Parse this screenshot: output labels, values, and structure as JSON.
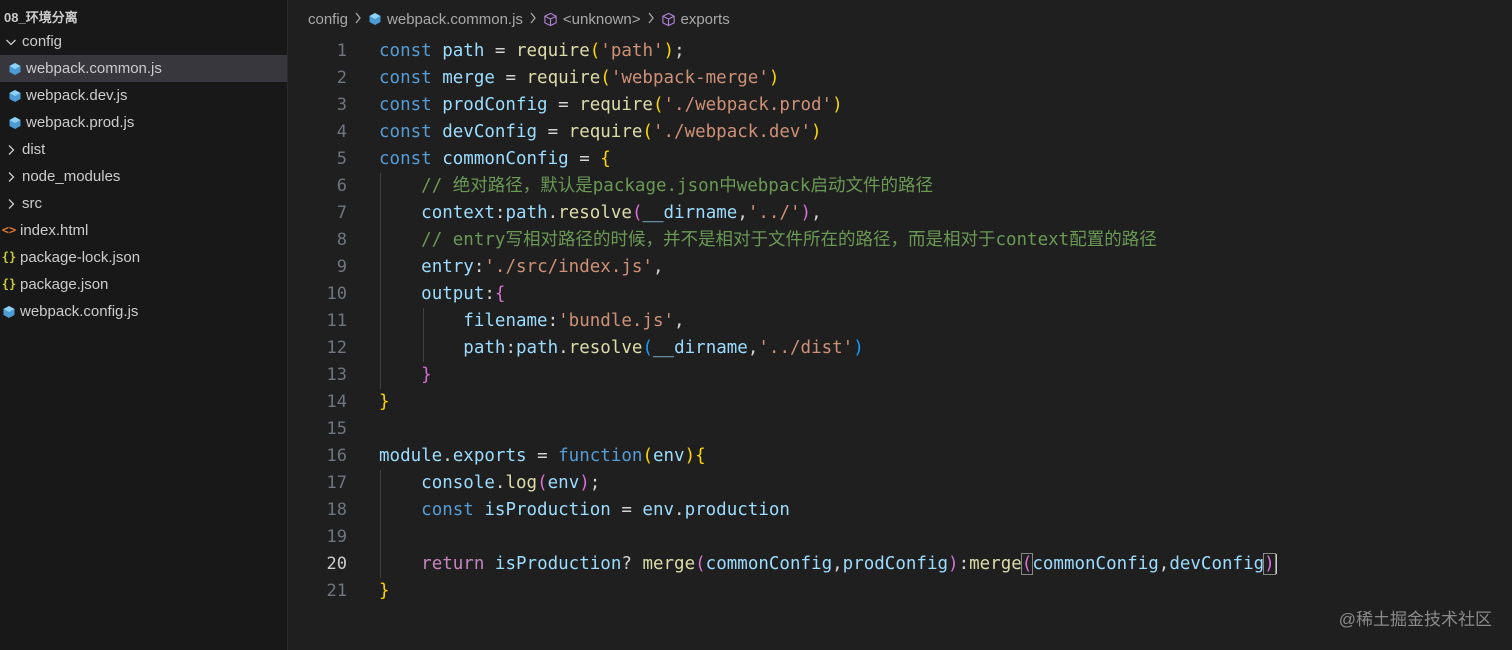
{
  "sidebar": {
    "title": "08_环境分离",
    "items": [
      {
        "label": "config",
        "type": "folder-open",
        "indent": 0
      },
      {
        "label": "webpack.common.js",
        "type": "js",
        "indent": 1,
        "selected": true
      },
      {
        "label": "webpack.dev.js",
        "type": "js",
        "indent": 1
      },
      {
        "label": "webpack.prod.js",
        "type": "js",
        "indent": 1
      },
      {
        "label": "dist",
        "type": "folder",
        "indent": 0
      },
      {
        "label": "node_modules",
        "type": "folder",
        "indent": 0
      },
      {
        "label": "src",
        "type": "folder",
        "indent": 0
      },
      {
        "label": "index.html",
        "type": "html",
        "indent": 0
      },
      {
        "label": "package-lock.json",
        "type": "json",
        "indent": 0
      },
      {
        "label": "package.json",
        "type": "json",
        "indent": 0
      },
      {
        "label": "webpack.config.js",
        "type": "js",
        "indent": 0
      }
    ]
  },
  "breadcrumb": {
    "folder": "config",
    "file": "webpack.common.js",
    "symbol1": "<unknown>",
    "symbol2": "exports"
  },
  "editor": {
    "active_line": 20,
    "lines": [
      [
        [
          "kw",
          "const "
        ],
        [
          "id",
          "path"
        ],
        [
          "pl",
          " = "
        ],
        [
          "fn",
          "require"
        ],
        [
          "p1",
          "("
        ],
        [
          "str",
          "'path'"
        ],
        [
          "p1",
          ")"
        ],
        [
          "pl",
          ";"
        ]
      ],
      [
        [
          "kw",
          "const "
        ],
        [
          "id",
          "merge"
        ],
        [
          "pl",
          " = "
        ],
        [
          "fn",
          "require"
        ],
        [
          "p1",
          "("
        ],
        [
          "str",
          "'webpack-merge'"
        ],
        [
          "p1",
          ")"
        ]
      ],
      [
        [
          "kw",
          "const "
        ],
        [
          "id",
          "prodConfig"
        ],
        [
          "pl",
          " = "
        ],
        [
          "fn",
          "require"
        ],
        [
          "p1",
          "("
        ],
        [
          "str",
          "'./webpack.prod'"
        ],
        [
          "p1",
          ")"
        ]
      ],
      [
        [
          "kw",
          "const "
        ],
        [
          "id",
          "devConfig"
        ],
        [
          "pl",
          " = "
        ],
        [
          "fn",
          "require"
        ],
        [
          "p1",
          "("
        ],
        [
          "str",
          "'./webpack.dev'"
        ],
        [
          "p1",
          ")"
        ]
      ],
      [
        [
          "kw",
          "const "
        ],
        [
          "id",
          "commonConfig"
        ],
        [
          "pl",
          " = "
        ],
        [
          "p1",
          "{"
        ]
      ],
      [
        [
          "pl",
          "    "
        ],
        [
          "cm",
          "// 绝对路径，默认是package.json中webpack启动文件的路径"
        ]
      ],
      [
        [
          "pl",
          "    "
        ],
        [
          "id",
          "context"
        ],
        [
          "pl",
          ":"
        ],
        [
          "id",
          "path"
        ],
        [
          "pl",
          "."
        ],
        [
          "fn",
          "resolve"
        ],
        [
          "p2",
          "("
        ],
        [
          "id",
          "__dirname"
        ],
        [
          "pl",
          ","
        ],
        [
          "str",
          "'../'"
        ],
        [
          "p2",
          ")"
        ],
        [
          "pl",
          ","
        ]
      ],
      [
        [
          "pl",
          "    "
        ],
        [
          "cm",
          "// entry写相对路径的时候，并不是相对于文件所在的路径，而是相对于context配置的路径"
        ]
      ],
      [
        [
          "pl",
          "    "
        ],
        [
          "id",
          "entry"
        ],
        [
          "pl",
          ":"
        ],
        [
          "str",
          "'./src/index.js'"
        ],
        [
          "pl",
          ","
        ]
      ],
      [
        [
          "pl",
          "    "
        ],
        [
          "id",
          "output"
        ],
        [
          "pl",
          ":"
        ],
        [
          "p2",
          "{"
        ]
      ],
      [
        [
          "pl",
          "        "
        ],
        [
          "id",
          "filename"
        ],
        [
          "pl",
          ":"
        ],
        [
          "str",
          "'bundle.js'"
        ],
        [
          "pl",
          ","
        ]
      ],
      [
        [
          "pl",
          "        "
        ],
        [
          "id",
          "path"
        ],
        [
          "pl",
          ":"
        ],
        [
          "id",
          "path"
        ],
        [
          "pl",
          "."
        ],
        [
          "fn",
          "resolve"
        ],
        [
          "p3",
          "("
        ],
        [
          "id",
          "__dirname"
        ],
        [
          "pl",
          ","
        ],
        [
          "str",
          "'../dist'"
        ],
        [
          "p3",
          ")"
        ]
      ],
      [
        [
          "pl",
          "    "
        ],
        [
          "p2",
          "}"
        ]
      ],
      [
        [
          "p1",
          "}"
        ]
      ],
      [],
      [
        [
          "id",
          "module"
        ],
        [
          "pl",
          "."
        ],
        [
          "id",
          "exports"
        ],
        [
          "pl",
          " = "
        ],
        [
          "kw",
          "function"
        ],
        [
          "p1",
          "("
        ],
        [
          "id",
          "env"
        ],
        [
          "p1",
          ")"
        ],
        [
          "p1",
          "{"
        ]
      ],
      [
        [
          "pl",
          "    "
        ],
        [
          "id",
          "console"
        ],
        [
          "pl",
          "."
        ],
        [
          "fn",
          "log"
        ],
        [
          "p2",
          "("
        ],
        [
          "id",
          "env"
        ],
        [
          "p2",
          ")"
        ],
        [
          "pl",
          ";"
        ]
      ],
      [
        [
          "pl",
          "    "
        ],
        [
          "kw",
          "const "
        ],
        [
          "id",
          "isProduction"
        ],
        [
          "pl",
          " = "
        ],
        [
          "id",
          "env"
        ],
        [
          "pl",
          "."
        ],
        [
          "id",
          "production"
        ]
      ],
      [],
      [
        [
          "pl",
          "    "
        ],
        [
          "ctl",
          "return "
        ],
        [
          "id",
          "isProduction"
        ],
        [
          "pl",
          "? "
        ],
        [
          "fn",
          "merge"
        ],
        [
          "p2",
          "("
        ],
        [
          "id",
          "commonConfig"
        ],
        [
          "pl",
          ","
        ],
        [
          "id",
          "prodConfig"
        ],
        [
          "p2",
          ")"
        ],
        [
          "pl",
          ":"
        ],
        [
          "fn",
          "merge"
        ],
        [
          "p2b",
          "("
        ],
        [
          "id",
          "commonConfig"
        ],
        [
          "pl",
          ","
        ],
        [
          "id",
          "devConfig"
        ],
        [
          "p2b",
          ")"
        ]
      ],
      [
        [
          "p1",
          "}"
        ]
      ]
    ]
  },
  "watermark": "@稀土掘金技术社区",
  "colors": {
    "background": "#1f1f1f",
    "sidebar": "#181818",
    "selected": "#37373d",
    "keyword": "#569cd6",
    "string": "#ce9178",
    "comment": "#6a9955"
  }
}
